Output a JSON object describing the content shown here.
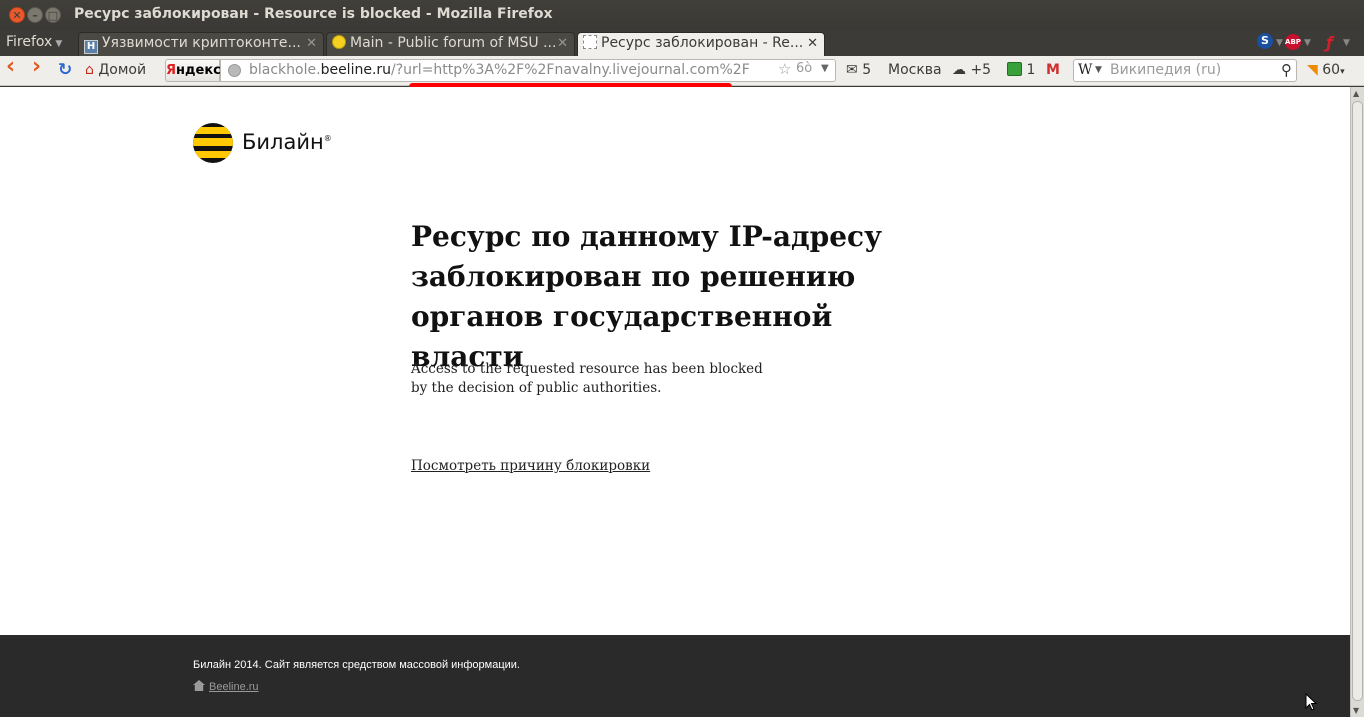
{
  "window": {
    "title": "Ресурс заблокирован - Resource is blocked - Mozilla Firefox",
    "close_glyph": "✕",
    "min_glyph": "–",
    "max_glyph": "□"
  },
  "tabbar": {
    "menu_label": "Firefox",
    "tabs": [
      {
        "label": "Уязвимости криптоконте...",
        "icon": "habr-favicon-icon",
        "active": false
      },
      {
        "label": "Main - Public forum of MSU ...",
        "icon": "smiley-favicon-icon",
        "active": false
      },
      {
        "label": "Ресурс заблокирован - Re...",
        "icon": "blank-page-icon",
        "active": true
      }
    ],
    "close_glyph": "✕"
  },
  "navbar": {
    "back_glyph": "‹",
    "forward_glyph": "›",
    "reload_glyph": "↻",
    "home_label": "Домой",
    "yandex_label_red": "Я",
    "yandex_label_rest": "ндекс",
    "url_domain_prefix": "blackhole.",
    "url_domain": "beeline.ru",
    "url_path": "/?url=http%3A%2F%2Fnavalny.livejournal.com%2F",
    "star_glyph": "☆",
    "glasses_glyph": "6ò",
    "mail_count": "5",
    "city": "Москва",
    "weather": "+5",
    "notify_count": "1",
    "search_engine_glyph": "W",
    "search_placeholder": "Википедия (ru)",
    "rss_count": "60"
  },
  "page": {
    "logo_text": "Билайн",
    "logo_mark": "®",
    "heading": "Ресурс по данному IP-адресу заблокирован по решению органов государственной власти",
    "subtext_line1": "Access to the requested resource has been blocked",
    "subtext_line2": "by the decision of public authorities.",
    "reason_link": "Посмотреть причину блокировки"
  },
  "footer": {
    "text": "Билайн 2014. Сайт является средством массовой информации.",
    "link": "Beeline.ru"
  },
  "colors": {
    "beeline_yellow": "#ffc800",
    "beeline_black": "#111111",
    "footer_bg": "#2a2a2a",
    "url_highlight": "#ff0000"
  }
}
